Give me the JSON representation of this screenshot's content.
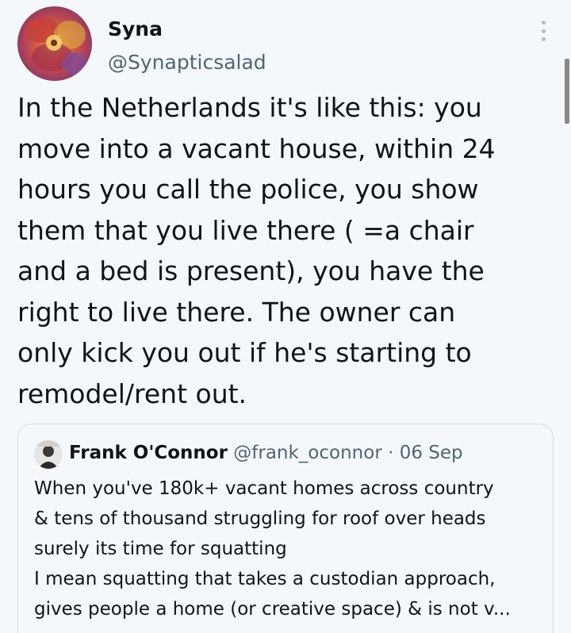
{
  "author": {
    "display_name": "Syna",
    "handle": "@Synapticsalad"
  },
  "tweet": {
    "text": "In the Netherlands it's like this: you\nmove into a vacant house, within 24\nhours you call the police, you show\nthem that you live there ( =a chair\nand a bed is present), you have the\nright to live there. The owner can\nonly kick you out if he's starting to\nremodel/rent out."
  },
  "quoted_tweet": {
    "display_name": "Frank O'Connor",
    "handle": "@frank_oconnor",
    "separator": "·",
    "date": "06 Sep",
    "text": "When you've 180k+ vacant homes across country\n& tens of thousand struggling for roof over heads\nsurely its time for squatting\nI mean squatting that takes a custodian approach,\ngives people a home (or creative space) & is not v..."
  },
  "icons": {
    "avatar": "painted-flower-avatar",
    "more": "vertical-ellipsis-icon",
    "quote_avatar": "person-photo-avatar"
  },
  "colors": {
    "background": "#f5f8fa",
    "text_primary": "#0f1419",
    "text_secondary": "#536471",
    "border": "#cfd9de",
    "more_dots": "#9fc2dc"
  }
}
